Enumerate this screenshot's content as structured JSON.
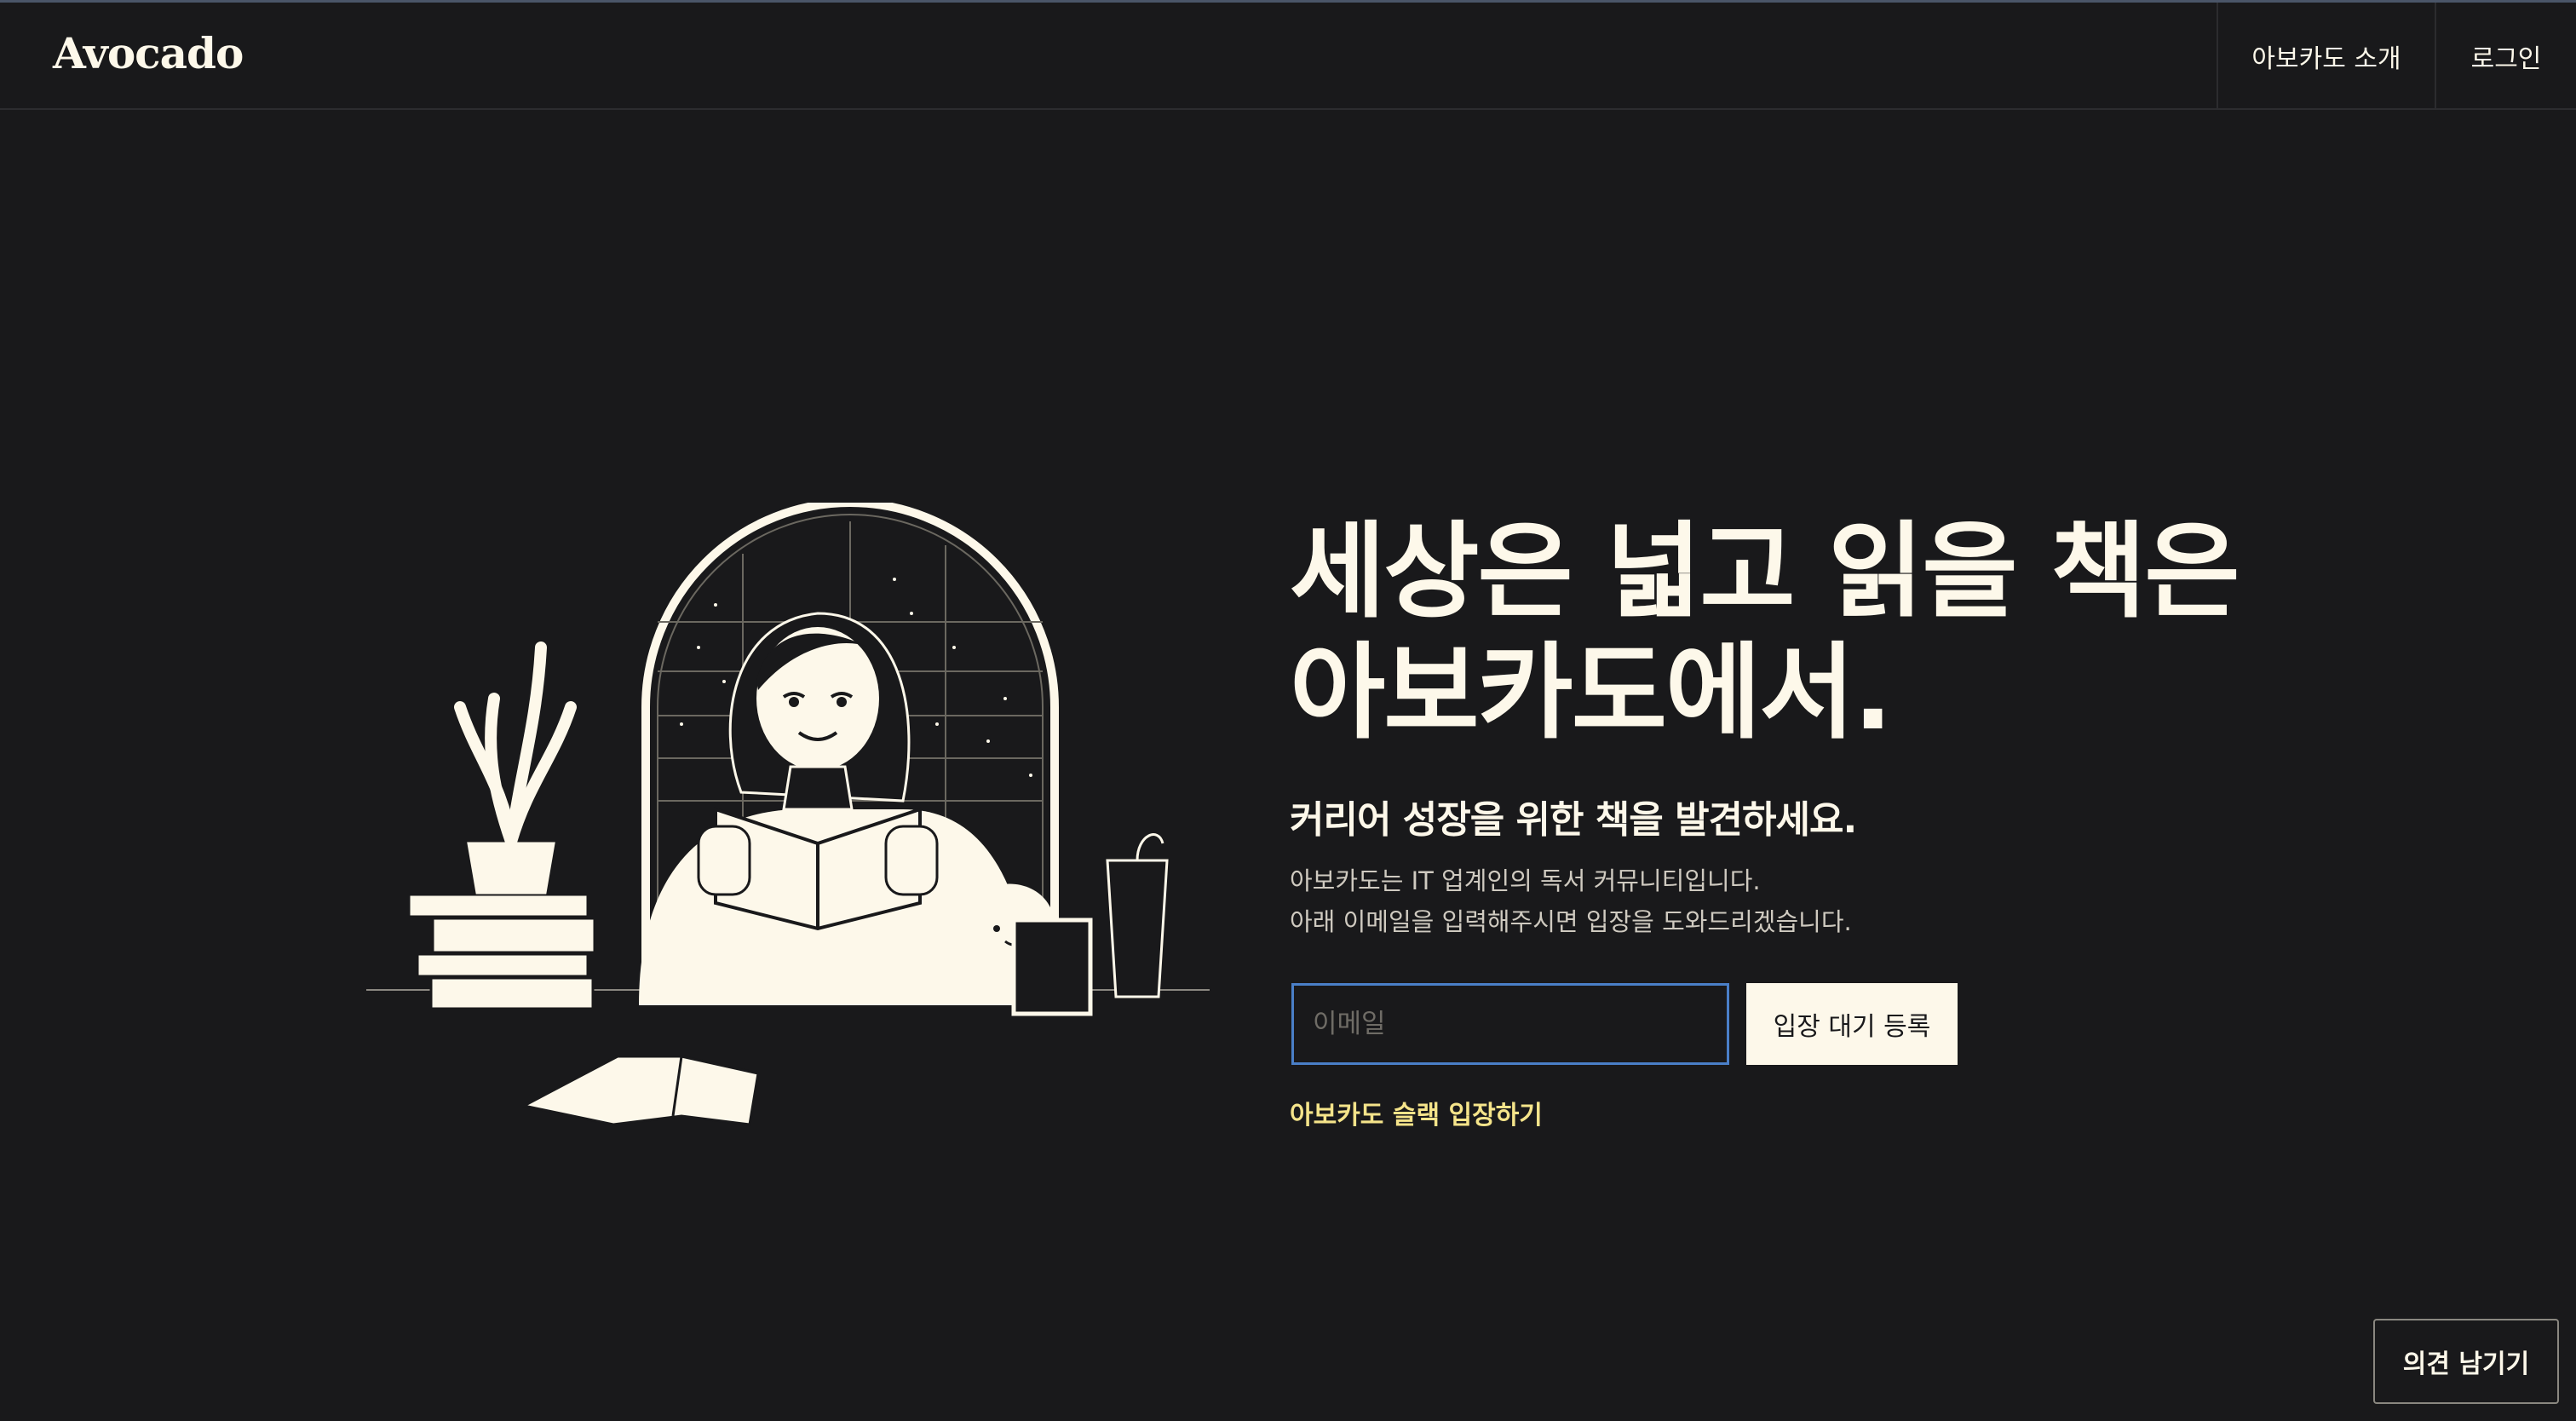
{
  "header": {
    "logo": "Avocado",
    "nav": [
      {
        "label": "아보카도 소개"
      },
      {
        "label": "로그인"
      }
    ]
  },
  "hero": {
    "title_line1": "세상은 넓고 읽을 책은",
    "title_line2": "아보카도에서.",
    "subtitle": "커리어 성장을 위한 책을 발견하세요.",
    "desc_line1": "아보카도는 IT 업계인의 독서 커뮤니티입니다.",
    "desc_line2": "아래 이메일을 입력해주시면 입장을 도와드리겠습니다.",
    "email_placeholder": "이메일",
    "email_value": "",
    "register_label": "입장 대기 등록",
    "slack_link": "아보카도 슬랙 입장하기"
  },
  "feedback": {
    "label": "의견 남기기"
  },
  "colors": {
    "background": "#19191b",
    "cream": "#fdf8ea",
    "accent_yellow": "#f5e48a",
    "input_focus": "#4a7fc8"
  },
  "illustration": {
    "icon": "woman-reading-illustration"
  }
}
